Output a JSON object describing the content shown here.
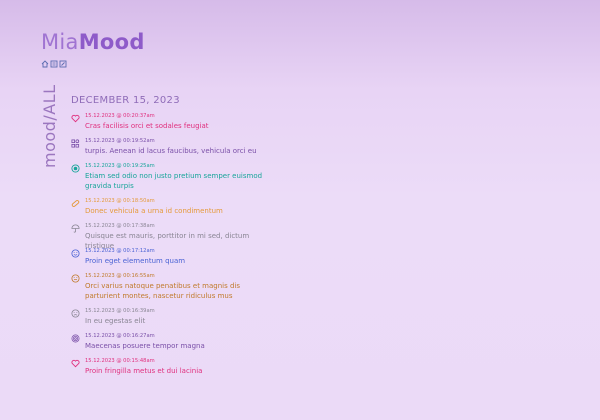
{
  "app": {
    "title_a": "Mia",
    "title_b": "Mood"
  },
  "nav": [
    {
      "icon": "home-icon"
    },
    {
      "icon": "list-icon"
    },
    {
      "icon": "edit-icon"
    }
  ],
  "side_label": "mood/ALL",
  "date_heading": "DECEMBER 15, 2023",
  "colors": {
    "pink": "#e0307e",
    "purple": "#7a50a8",
    "teal": "#18a59a",
    "orange": "#e59a3a",
    "gray": "#8a8694",
    "blue": "#4a62d4",
    "brown": "#c17a2c"
  },
  "entries": [
    {
      "icon": "heart-icon",
      "timestamp": "15.12.2023 @ 00:20:37am",
      "text": "Cras facilisis orci et sodales feugiat",
      "color": "#e0307e"
    },
    {
      "icon": "shapes-icon",
      "timestamp": "15.12.2023 @ 00:19:52am",
      "text": "turpis. Aenean id lacus faucibus, vehicula orci eu",
      "color": "#7a50a8"
    },
    {
      "icon": "target-icon",
      "timestamp": "15.12.2023 @ 00:19:25am",
      "text": "Etiam sed odio non justo pretium semper euismod gravida turpis",
      "color": "#18a59a"
    },
    {
      "icon": "bandage-icon",
      "timestamp": "15.12.2023 @ 00:18:50am",
      "text": "Donec vehicula a urna id condimentum",
      "color": "#e59a3a"
    },
    {
      "icon": "umbrella-icon",
      "timestamp": "15.12.2023 @ 00:17:38am",
      "text": "Quisque est mauris, porttitor in mi sed, dictum tristique",
      "color": "#8a8694"
    },
    {
      "icon": "smile-icon",
      "timestamp": "15.12.2023 @ 00:17:12am",
      "text": "Proin eget elementum quam",
      "color": "#4a62d4"
    },
    {
      "icon": "neutral-face-icon",
      "timestamp": "15.12.2023 @ 00:16:55am",
      "text": "Orci varius natoque penatibus et magnis dis parturient montes, nascetur ridiculus mus",
      "color": "#c17a2c"
    },
    {
      "icon": "sad-face-icon",
      "timestamp": "15.12.2023 @ 00:16:39am",
      "text": "In eu egestas elit",
      "color": "#8a8694"
    },
    {
      "icon": "spiral-icon",
      "timestamp": "15.12.2023 @ 00:16:27am",
      "text": "Maecenas posuere tempor magna",
      "color": "#7a50a8"
    },
    {
      "icon": "heart-icon",
      "timestamp": "15.12.2023 @ 00:15:48am",
      "text": "Proin fringilla metus et dui lacinia",
      "color": "#e0307e"
    }
  ]
}
